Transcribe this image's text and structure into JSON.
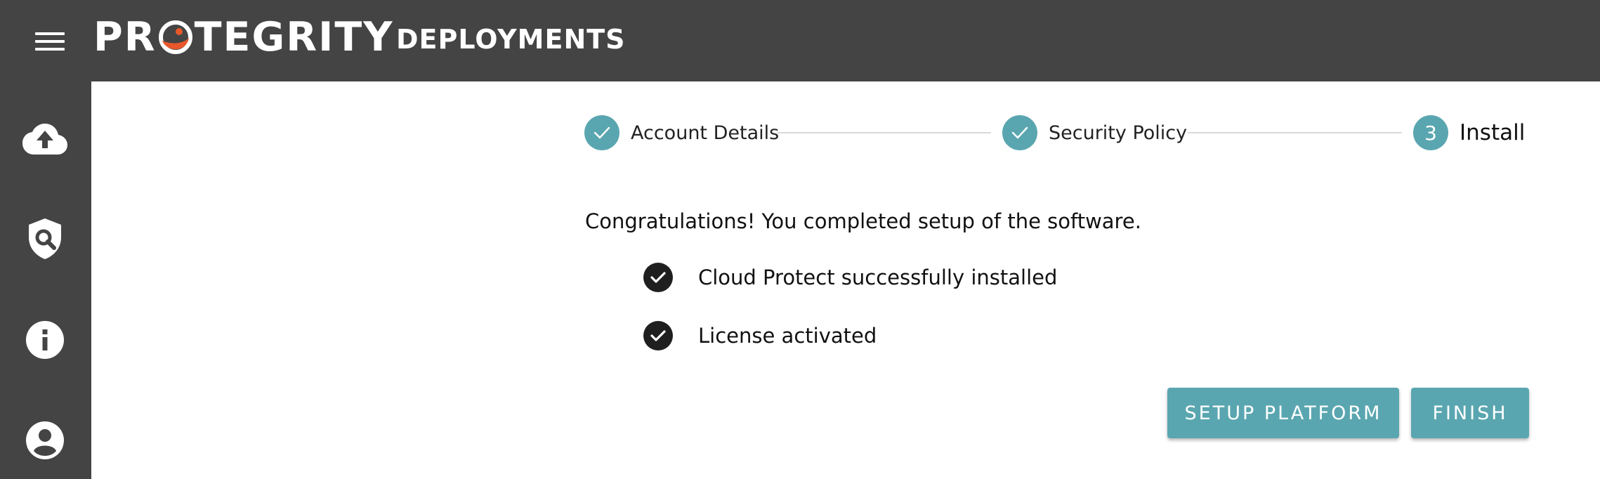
{
  "header": {
    "brand_name_part1": "PR",
    "brand_name_part2": "TEGRITY",
    "section_title": "DEPLOYMENTS",
    "menu_icon": "hamburger-menu-icon",
    "logo_accent_color": "#e8582a"
  },
  "sidebar": {
    "items": [
      {
        "icon": "cloud-upload-icon"
      },
      {
        "icon": "shield-search-icon"
      },
      {
        "icon": "info-icon"
      },
      {
        "icon": "account-icon"
      }
    ]
  },
  "stepper": {
    "steps": [
      {
        "label": "Account Details",
        "state": "complete",
        "indicator": "check"
      },
      {
        "label": "Security Policy",
        "state": "complete",
        "indicator": "check"
      },
      {
        "label": "Install",
        "state": "active",
        "indicator": "3"
      }
    ]
  },
  "content": {
    "message": "Congratulations! You completed setup of the software.",
    "status_items": [
      {
        "text": "Cloud Protect successfully installed",
        "icon": "check-circle-icon"
      },
      {
        "text": "License activated",
        "icon": "check-circle-icon"
      }
    ]
  },
  "actions": {
    "setup_platform_label": "SETUP PLATFORM",
    "finish_label": "FINISH"
  },
  "colors": {
    "bar_background": "#444444",
    "accent": "#5aa6b0",
    "status_check": "#1f1f1f"
  }
}
